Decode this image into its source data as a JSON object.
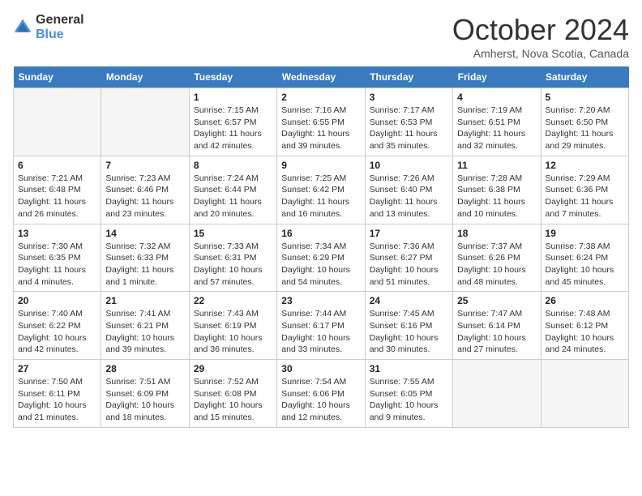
{
  "header": {
    "logo_line1": "General",
    "logo_line2": "Blue",
    "month": "October 2024",
    "location": "Amherst, Nova Scotia, Canada"
  },
  "days_of_week": [
    "Sunday",
    "Monday",
    "Tuesday",
    "Wednesday",
    "Thursday",
    "Friday",
    "Saturday"
  ],
  "weeks": [
    [
      {
        "day": "",
        "info": ""
      },
      {
        "day": "",
        "info": ""
      },
      {
        "day": "1",
        "info": "Sunrise: 7:15 AM\nSunset: 6:57 PM\nDaylight: 11 hours and 42 minutes."
      },
      {
        "day": "2",
        "info": "Sunrise: 7:16 AM\nSunset: 6:55 PM\nDaylight: 11 hours and 39 minutes."
      },
      {
        "day": "3",
        "info": "Sunrise: 7:17 AM\nSunset: 6:53 PM\nDaylight: 11 hours and 35 minutes."
      },
      {
        "day": "4",
        "info": "Sunrise: 7:19 AM\nSunset: 6:51 PM\nDaylight: 11 hours and 32 minutes."
      },
      {
        "day": "5",
        "info": "Sunrise: 7:20 AM\nSunset: 6:50 PM\nDaylight: 11 hours and 29 minutes."
      }
    ],
    [
      {
        "day": "6",
        "info": "Sunrise: 7:21 AM\nSunset: 6:48 PM\nDaylight: 11 hours and 26 minutes."
      },
      {
        "day": "7",
        "info": "Sunrise: 7:23 AM\nSunset: 6:46 PM\nDaylight: 11 hours and 23 minutes."
      },
      {
        "day": "8",
        "info": "Sunrise: 7:24 AM\nSunset: 6:44 PM\nDaylight: 11 hours and 20 minutes."
      },
      {
        "day": "9",
        "info": "Sunrise: 7:25 AM\nSunset: 6:42 PM\nDaylight: 11 hours and 16 minutes."
      },
      {
        "day": "10",
        "info": "Sunrise: 7:26 AM\nSunset: 6:40 PM\nDaylight: 11 hours and 13 minutes."
      },
      {
        "day": "11",
        "info": "Sunrise: 7:28 AM\nSunset: 6:38 PM\nDaylight: 11 hours and 10 minutes."
      },
      {
        "day": "12",
        "info": "Sunrise: 7:29 AM\nSunset: 6:36 PM\nDaylight: 11 hours and 7 minutes."
      }
    ],
    [
      {
        "day": "13",
        "info": "Sunrise: 7:30 AM\nSunset: 6:35 PM\nDaylight: 11 hours and 4 minutes."
      },
      {
        "day": "14",
        "info": "Sunrise: 7:32 AM\nSunset: 6:33 PM\nDaylight: 11 hours and 1 minute."
      },
      {
        "day": "15",
        "info": "Sunrise: 7:33 AM\nSunset: 6:31 PM\nDaylight: 10 hours and 57 minutes."
      },
      {
        "day": "16",
        "info": "Sunrise: 7:34 AM\nSunset: 6:29 PM\nDaylight: 10 hours and 54 minutes."
      },
      {
        "day": "17",
        "info": "Sunrise: 7:36 AM\nSunset: 6:27 PM\nDaylight: 10 hours and 51 minutes."
      },
      {
        "day": "18",
        "info": "Sunrise: 7:37 AM\nSunset: 6:26 PM\nDaylight: 10 hours and 48 minutes."
      },
      {
        "day": "19",
        "info": "Sunrise: 7:38 AM\nSunset: 6:24 PM\nDaylight: 10 hours and 45 minutes."
      }
    ],
    [
      {
        "day": "20",
        "info": "Sunrise: 7:40 AM\nSunset: 6:22 PM\nDaylight: 10 hours and 42 minutes."
      },
      {
        "day": "21",
        "info": "Sunrise: 7:41 AM\nSunset: 6:21 PM\nDaylight: 10 hours and 39 minutes."
      },
      {
        "day": "22",
        "info": "Sunrise: 7:43 AM\nSunset: 6:19 PM\nDaylight: 10 hours and 36 minutes."
      },
      {
        "day": "23",
        "info": "Sunrise: 7:44 AM\nSunset: 6:17 PM\nDaylight: 10 hours and 33 minutes."
      },
      {
        "day": "24",
        "info": "Sunrise: 7:45 AM\nSunset: 6:16 PM\nDaylight: 10 hours and 30 minutes."
      },
      {
        "day": "25",
        "info": "Sunrise: 7:47 AM\nSunset: 6:14 PM\nDaylight: 10 hours and 27 minutes."
      },
      {
        "day": "26",
        "info": "Sunrise: 7:48 AM\nSunset: 6:12 PM\nDaylight: 10 hours and 24 minutes."
      }
    ],
    [
      {
        "day": "27",
        "info": "Sunrise: 7:50 AM\nSunset: 6:11 PM\nDaylight: 10 hours and 21 minutes."
      },
      {
        "day": "28",
        "info": "Sunrise: 7:51 AM\nSunset: 6:09 PM\nDaylight: 10 hours and 18 minutes."
      },
      {
        "day": "29",
        "info": "Sunrise: 7:52 AM\nSunset: 6:08 PM\nDaylight: 10 hours and 15 minutes."
      },
      {
        "day": "30",
        "info": "Sunrise: 7:54 AM\nSunset: 6:06 PM\nDaylight: 10 hours and 12 minutes."
      },
      {
        "day": "31",
        "info": "Sunrise: 7:55 AM\nSunset: 6:05 PM\nDaylight: 10 hours and 9 minutes."
      },
      {
        "day": "",
        "info": ""
      },
      {
        "day": "",
        "info": ""
      }
    ]
  ]
}
